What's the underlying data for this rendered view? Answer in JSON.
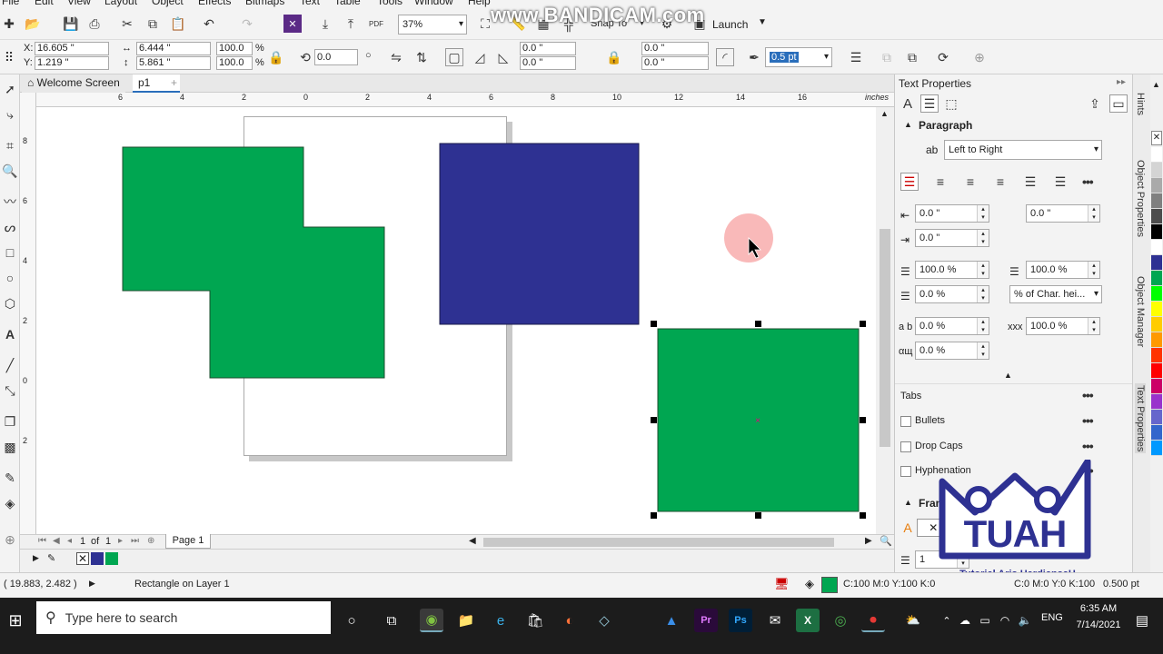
{
  "menu": [
    "File",
    "Edit",
    "View",
    "Layout",
    "Object",
    "Effects",
    "Bitmaps",
    "Text",
    "Table",
    "Tools",
    "Window",
    "Help"
  ],
  "toolbar": {
    "zoom": "37%",
    "snap_label": "Snap To",
    "launch_label": "Launch",
    "watermark": "www.BANDICAM.com"
  },
  "propbar": {
    "x": "16.605 \"",
    "y": "1.219 \"",
    "w": "6.444 \"",
    "h": "5.861 \"",
    "scale_x": "100.0",
    "scale_y": "100.0",
    "pct": "%",
    "angle": "0.0",
    "corner1": "0.0 \"",
    "corner2": "0.0 \"",
    "corner3": "0.0 \"",
    "corner4": "0.0 \"",
    "outline": "0.5 pt"
  },
  "tabs": {
    "welcome": "Welcome Screen",
    "page": "p1"
  },
  "ruler": {
    "units": "inches",
    "h_ticks": [
      "6",
      "4",
      "2",
      "0",
      "2",
      "4",
      "6",
      "8",
      "10",
      "12",
      "14",
      "16"
    ],
    "v_ticks": [
      "8",
      "6",
      "4",
      "2",
      "0",
      "2"
    ]
  },
  "nav": {
    "page_of": "1",
    "of_label": "of",
    "total": "1",
    "page_tab": "Page 1"
  },
  "panel": {
    "title": "Text Properties",
    "paragraph": "Paragraph",
    "direction": "Left to Right",
    "indent_left": "0.0 \"",
    "indent_right": "0.0 \"",
    "indent_first": "0.0 \"",
    "line_spacing": "100.0 %",
    "before_para": "100.0 %",
    "after_para": "0.0 %",
    "spacing_unit": "% of Char. hei...",
    "char_spacing": "0.0 %",
    "word_spacing": "100.0 %",
    "lang_spacing": "0.0 %",
    "tabs": "Tabs",
    "bullets": "Bullets",
    "drop_caps": "Drop Caps",
    "hyphenation": "Hyphenation",
    "frame": "Frame",
    "columns": "1"
  },
  "side_tabs": [
    "Hints",
    "Object Properties",
    "Object Manager",
    "Text Properties"
  ],
  "logo": {
    "name": "TUAH",
    "subtitle": "Tutorial Aris HardiansaH"
  },
  "status": {
    "coords": "( 19.883, 2.482 )",
    "object": "Rectangle on Layer 1",
    "fill": "C:100 M:0 Y:100 K:0",
    "outline_info": "C:0 M:0 Y:0 K:100",
    "outline_width": "0.500 pt"
  },
  "taskbar": {
    "search_placeholder": "Type here to search",
    "time": "6:35 AM",
    "date": "7/14/2021",
    "lang": "ENG"
  },
  "colors": {
    "green": "#00a651",
    "navy": "#2e3192",
    "accent": "#2a6ebb"
  },
  "palette_colors": [
    "#ffffff",
    "#d4d4d4",
    "#aaaaaa",
    "#808080",
    "#4d4d4d",
    "#000000",
    "#ffffff",
    "#2e3192",
    "#00a651",
    "#00ff00",
    "#ffff00",
    "#ffcc00",
    "#ff9900",
    "#ff3300",
    "#ff0000",
    "#cc0066",
    "#9933cc",
    "#6666cc",
    "#3366cc",
    "#0099ff"
  ]
}
